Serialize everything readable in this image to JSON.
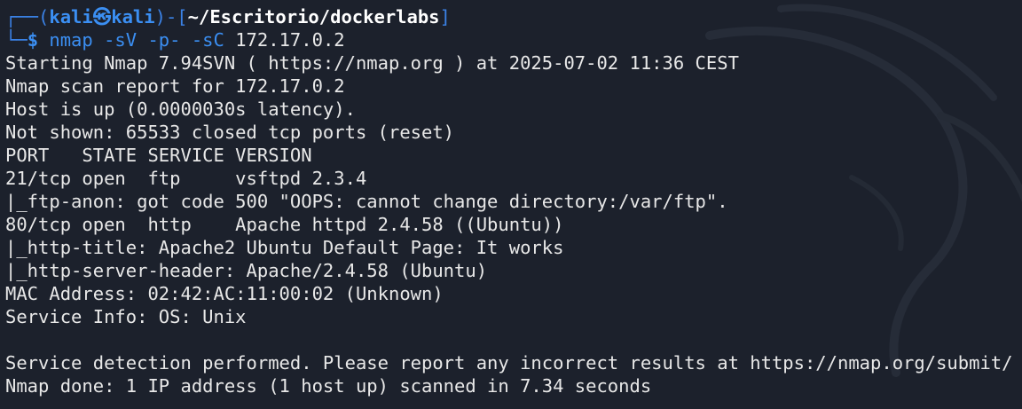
{
  "prompt": {
    "frame_top_left": "┌──(",
    "user": "kali",
    "separator_icon": "kali-dragon-icon",
    "separator_glyph": "㉿",
    "host": "kali",
    "frame_mid": ")-[",
    "path": "~/Escritorio/dockerlabs",
    "frame_close": "]",
    "frame_bottom_left": "└─",
    "dollar": "$",
    "command": "nmap",
    "args": [
      " -sV",
      " -p-",
      " -sC"
    ],
    "target": " 172.17.0.2"
  },
  "output": [
    "Starting Nmap 7.94SVN ( https://nmap.org ) at 2025-07-02 11:36 CEST",
    "Nmap scan report for 172.17.0.2",
    "Host is up (0.0000030s latency).",
    "Not shown: 65533 closed tcp ports (reset)",
    "PORT   STATE SERVICE VERSION",
    "21/tcp open  ftp     vsftpd 2.3.4",
    "|_ftp-anon: got code 500 \"OOPS: cannot change directory:/var/ftp\".",
    "80/tcp open  http    Apache httpd 2.4.58 ((Ubuntu))",
    "|_http-title: Apache2 Ubuntu Default Page: It works",
    "|_http-server-header: Apache/2.4.58 (Ubuntu)",
    "MAC Address: 02:42:AC:11:00:02 (Unknown)",
    "Service Info: OS: Unix",
    "",
    "Service detection performed. Please report any incorrect results at https://nmap.org/submit/ .",
    "Nmap done: 1 IP address (1 host up) scanned in 7.34 seconds"
  ],
  "colors": {
    "background": "#1c212c",
    "prompt_blue": "#3b8ff3",
    "text": "#e8e8e8"
  }
}
